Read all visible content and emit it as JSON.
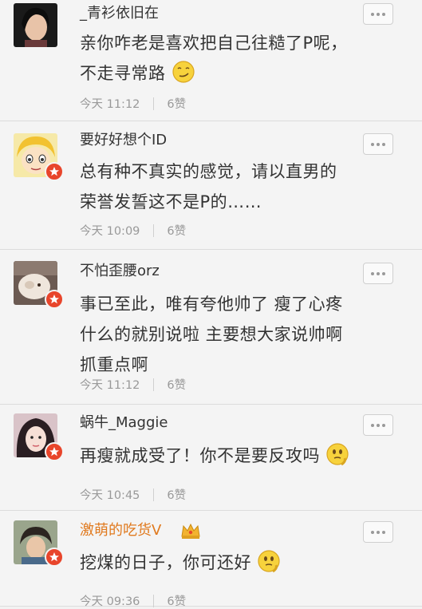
{
  "comments": [
    {
      "username": "_青衫依旧在",
      "line1": "亲你咋老是喜欢把自己往糙了P呢，",
      "line2": "不走寻常路",
      "time": "今天 11:12",
      "likes": "6赞",
      "emoji": "smirk-face"
    },
    {
      "username": "要好好想个ID",
      "line1": "总有种不真实的感觉，请以直男的",
      "line2": "荣誉发誓这不是P的……",
      "time": "今天 10:09",
      "likes": "6赞"
    },
    {
      "username": "不怕歪腰orz",
      "line1": "事已至此，唯有夸他帅了 瘦了心疼",
      "line2": "什么的就别说啦 主要想大家说帅啊",
      "line3": "抓重点啊",
      "time": "今天 11:12",
      "likes": "6赞"
    },
    {
      "username": "蜗牛_Maggie",
      "line1": "再瘦就成受了！你不是要反攻吗",
      "time": "今天 10:45",
      "likes": "6赞",
      "emoji": "thinking-face"
    },
    {
      "username": "激萌的吃货V",
      "line1": "挖煤的日子，你可还好",
      "time": "今天 09:36",
      "likes": "6赞",
      "emoji": "thinking-face"
    }
  ],
  "colors": {
    "vip_name": "#e07a1f",
    "badge": "#e8452b",
    "meta": "#999999"
  }
}
